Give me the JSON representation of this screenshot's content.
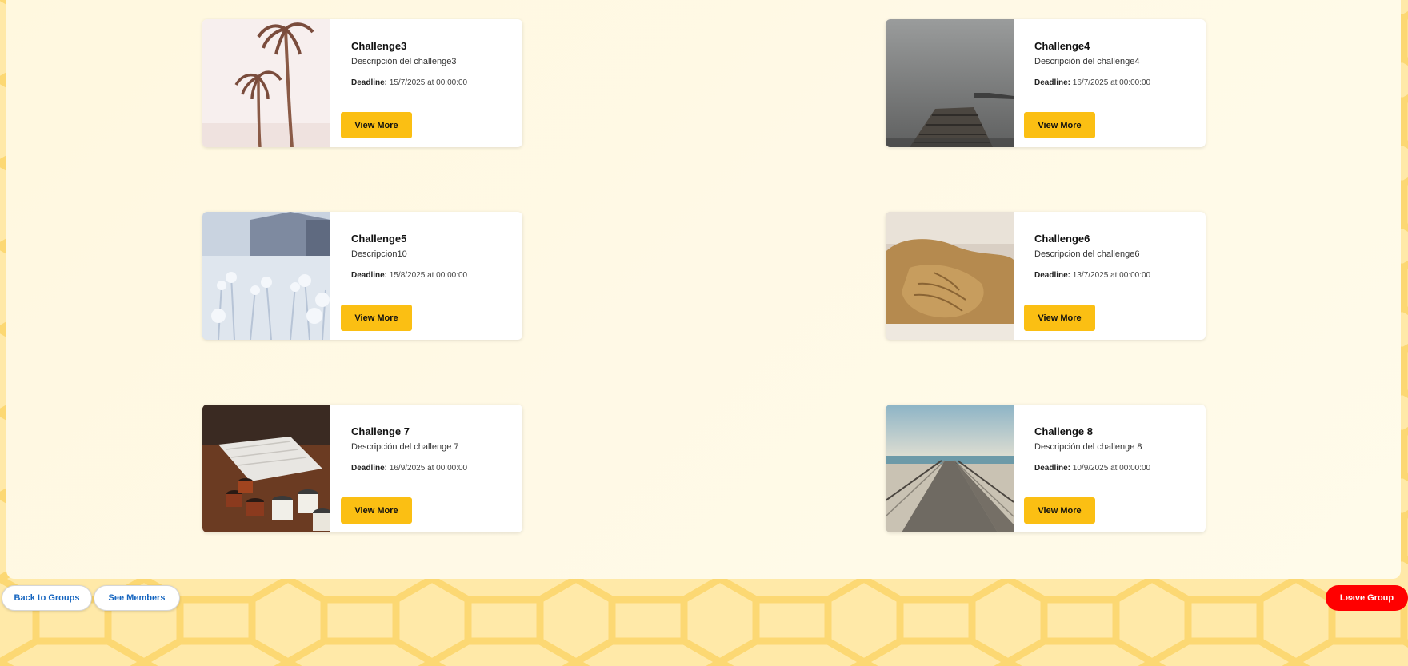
{
  "colors": {
    "accent": "#fbbf13",
    "leave": "#ff0000",
    "link": "#1565c0"
  },
  "challenges": [
    {
      "title": "Challenge3",
      "description": "Descripción del challenge3",
      "deadline_label": "Deadline:",
      "deadline_value": "15/7/2025 at 00:00:00",
      "button_label": "View More",
      "image_icon": "palm-trees-image"
    },
    {
      "title": "Challenge4",
      "description": "Descripción del challenge4",
      "deadline_label": "Deadline:",
      "deadline_value": "16/7/2025 at 00:00:00",
      "button_label": "View More",
      "image_icon": "foggy-pier-image"
    },
    {
      "title": "Challenge5",
      "description": "Descripcion10",
      "deadline_label": "Deadline:",
      "deadline_value": "15/8/2025 at 00:00:00",
      "button_label": "View More",
      "image_icon": "frosted-plants-image"
    },
    {
      "title": "Challenge6",
      "description": "Descripcion del challenge6",
      "deadline_label": "Deadline:",
      "deadline_value": "13/7/2025 at 00:00:00",
      "button_label": "View More",
      "image_icon": "walruses-image"
    },
    {
      "title": "Challenge 7",
      "description": "Descripción del challenge 7",
      "deadline_label": "Deadline:",
      "deadline_value": "16/9/2025 at 00:00:00",
      "button_label": "View More",
      "image_icon": "enamel-mugs-image"
    },
    {
      "title": "Challenge 8",
      "description": "Descripción del challenge 8",
      "deadline_label": "Deadline:",
      "deadline_value": "10/9/2025 at 00:00:00",
      "button_label": "View More",
      "image_icon": "boardwalk-image"
    }
  ],
  "footer": {
    "back_label": "Back to Groups",
    "members_label": "See Members",
    "leave_label": "Leave Group"
  }
}
